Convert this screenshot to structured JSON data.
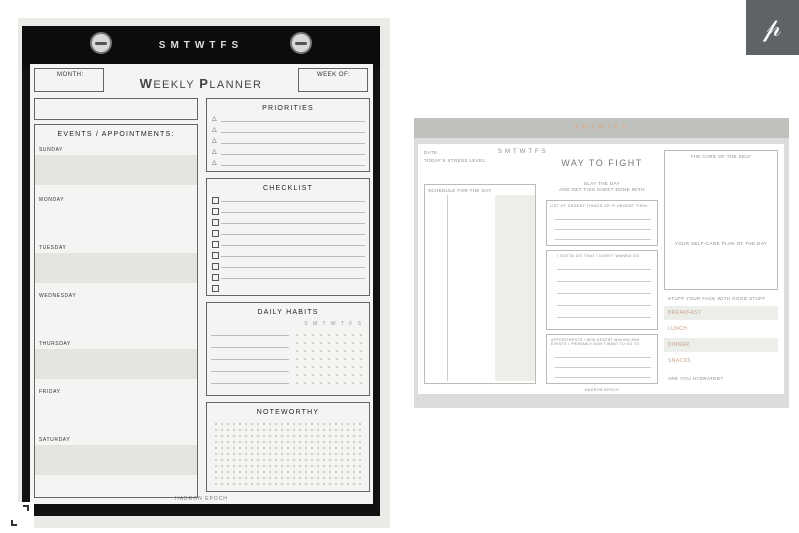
{
  "left_planner": {
    "days_header": "SMTWTFS",
    "month_label": "MONTH:",
    "title_prefix_big1": "W",
    "title_rest1": "EEKLY ",
    "title_prefix_big2": "P",
    "title_rest2": "LANNER",
    "week_label": "WEEK OF:",
    "events_title": "EVENTS / APPOINTMENTS:",
    "days": [
      "SUNDAY",
      "MONDAY",
      "TUESDAY",
      "WEDNESDAY",
      "THURSDAY",
      "FRIDAY",
      "SATURDAY"
    ],
    "priorities_title": "PRIORITIES",
    "checklist_title": "CHECKLIST",
    "habits_title": "DAILY HABITS",
    "habits_days": "S M T W T F S",
    "noteworthy_title": "NOTEWORTHY",
    "footer": "HADRON EPOCH",
    "priority_count_icon": "triangle-bullet-icon",
    "checklist_icon": "checkbox-icon"
  },
  "right_planner": {
    "header": "SMTWTFS",
    "title": "WAY TO FIGHT",
    "subtitle_line1": "SLAY THE DAY",
    "subtitle_line2": "AND GET THIS SHEET DONE WITH",
    "schedule_title": "SCHEDULE FOR THE DAY",
    "urgent_title": "LIST OF URGENT THINGS OR IF URGENT THEN",
    "gotta_title": "I GOTTA DO THAT I DIDN'T WANNA DO",
    "appointments_title": "APPOINTMENTS / NEW DESERT MAKING AND EVENTS I PROBABLY DON'T WANT TO GO TO",
    "care_title": "THE CARE OF THE SELF",
    "selfcare_title": "YOUR SELF-CARE PLAN OF THE DAY",
    "stuff_title": "STUFF YOUR FACE WITH GOOD STUFF",
    "meals": [
      "BREAKFAST",
      "LUNCH",
      "DINNER",
      "SNACKS"
    ],
    "water_label": "ARE YOU HYDRATED?",
    "footer": "HADRON EPOCH"
  },
  "pinterest": {
    "icon": "pinterest-icon",
    "glyph": "𝓅",
    "color": "#5f6366"
  },
  "expand_icon": "expand-icon"
}
